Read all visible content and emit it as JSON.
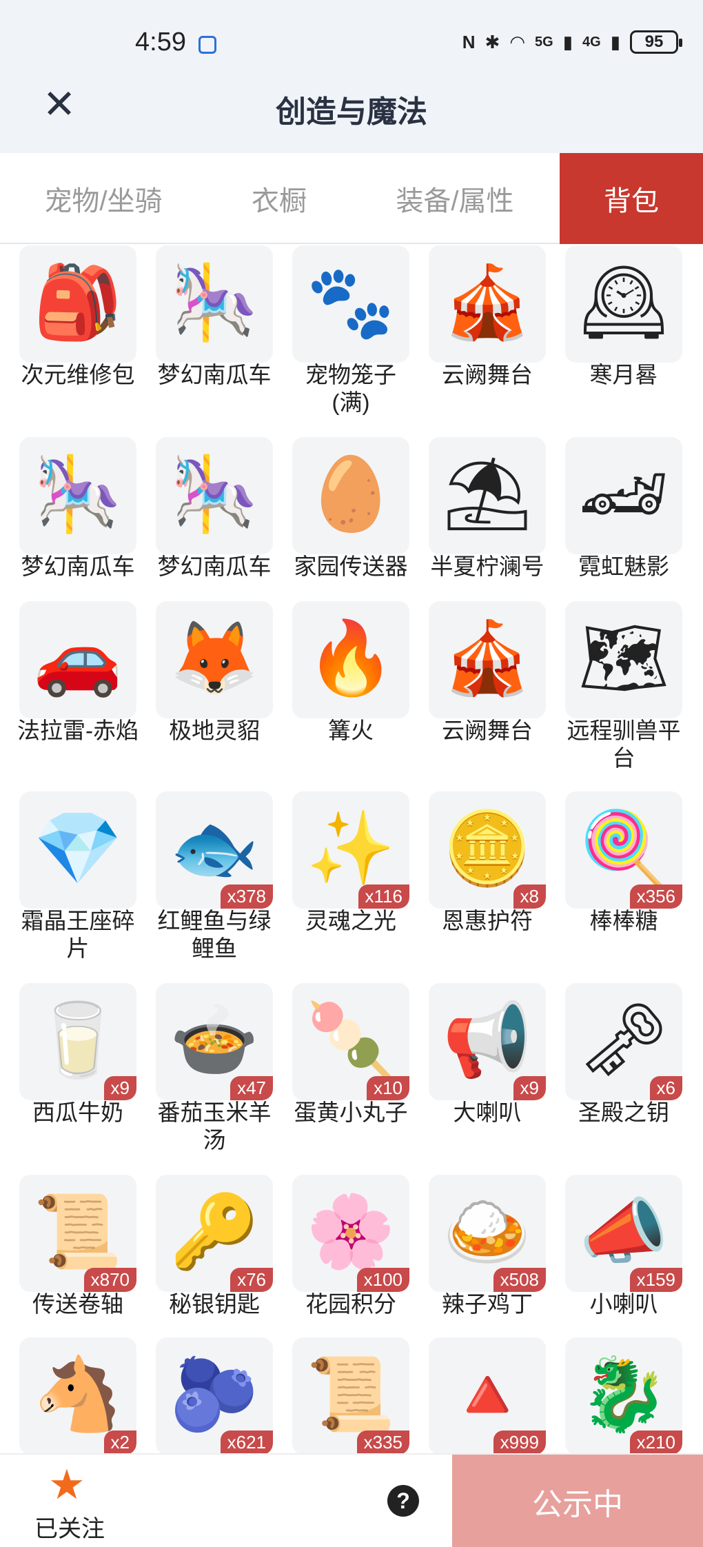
{
  "status_bar": {
    "time": "4:59",
    "nfc": "N",
    "signal_5g": "5G",
    "signal_4g": "4G",
    "battery": "95"
  },
  "header": {
    "title": "创造与魔法",
    "close_icon": "close-icon"
  },
  "tabs": [
    {
      "label": "宠物/坐骑",
      "active": false
    },
    {
      "label": "衣橱",
      "active": false
    },
    {
      "label": "装备/属性",
      "active": false
    },
    {
      "label": "背包",
      "active": true
    }
  ],
  "items": [
    {
      "name": "次元维修包",
      "qty": "",
      "icon": "🎒"
    },
    {
      "name": "梦幻南瓜车",
      "qty": "",
      "icon": "🎠"
    },
    {
      "name": "宠物笼子(满)",
      "qty": "",
      "icon": "🐾"
    },
    {
      "name": "云阙舞台",
      "qty": "",
      "icon": "🎪"
    },
    {
      "name": "寒月晷",
      "qty": "",
      "icon": "🕰"
    },
    {
      "name": "梦幻南瓜车",
      "qty": "",
      "icon": "🎠"
    },
    {
      "name": "梦幻南瓜车",
      "qty": "",
      "icon": "🎠"
    },
    {
      "name": "家园传送器",
      "qty": "",
      "icon": "🥚"
    },
    {
      "name": "半夏柠澜号",
      "qty": "",
      "icon": "⛱"
    },
    {
      "name": "霓虹魅影",
      "qty": "",
      "icon": "🏎"
    },
    {
      "name": "法拉雷-赤焰",
      "qty": "",
      "icon": "🚗"
    },
    {
      "name": "极地灵貂",
      "qty": "",
      "icon": "🦊"
    },
    {
      "name": "篝火",
      "qty": "",
      "icon": "🔥"
    },
    {
      "name": "云阙舞台",
      "qty": "",
      "icon": "🎪"
    },
    {
      "name": "远程驯兽平台",
      "qty": "",
      "icon": "🗺"
    },
    {
      "name": "霜晶王座碎片",
      "qty": "",
      "icon": "💎"
    },
    {
      "name": "红鲤鱼与绿鲤鱼",
      "qty": "x378",
      "icon": "🐟"
    },
    {
      "name": "灵魂之光",
      "qty": "x116",
      "icon": "✨"
    },
    {
      "name": "恩惠护符",
      "qty": "x8",
      "icon": "🪙"
    },
    {
      "name": "棒棒糖",
      "qty": "x356",
      "icon": "🍭"
    },
    {
      "name": "西瓜牛奶",
      "qty": "x9",
      "icon": "🥛"
    },
    {
      "name": "番茄玉米羊汤",
      "qty": "x47",
      "icon": "🍲"
    },
    {
      "name": "蛋黄小丸子",
      "qty": "x10",
      "icon": "🍡"
    },
    {
      "name": "大喇叭",
      "qty": "x9",
      "icon": "📢"
    },
    {
      "name": "圣殿之钥",
      "qty": "x6",
      "icon": "🗝"
    },
    {
      "name": "传送卷轴",
      "qty": "x870",
      "icon": "📜"
    },
    {
      "name": "秘银钥匙",
      "qty": "x76",
      "icon": "🔑"
    },
    {
      "name": "花园积分",
      "qty": "x100",
      "icon": "🌸"
    },
    {
      "name": "辣子鸡丁",
      "qty": "x508",
      "icon": "🍛"
    },
    {
      "name": "小喇叭",
      "qty": "x159",
      "icon": "📣"
    },
    {
      "name": "",
      "qty": "x2",
      "icon": "🐴"
    },
    {
      "name": "",
      "qty": "x621",
      "icon": "🫐"
    },
    {
      "name": "",
      "qty": "x335",
      "icon": "📜"
    },
    {
      "name": "",
      "qty": "x999",
      "icon": "🔺"
    },
    {
      "name": "",
      "qty": "x210",
      "icon": "🐉"
    }
  ],
  "bottom_bar": {
    "follow_label": "已关注",
    "help": "?",
    "public_label": "公示中"
  },
  "colors": {
    "accent_red": "#c8382e",
    "qty_badge": "#c84a4a",
    "public_button": "#e7a09c",
    "star": "#f26b1d"
  }
}
